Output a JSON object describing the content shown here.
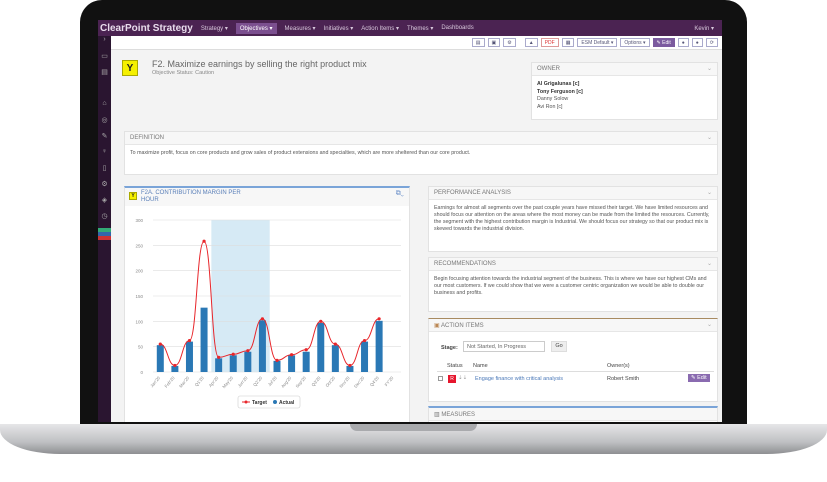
{
  "nav": {
    "brand": "ClearPoint Strategy",
    "items": [
      "Strategy ▾",
      "Objectives ▾",
      "Measures ▾",
      "Initiatives ▾",
      "Action Items ▾",
      "Themes ▾",
      "Dashboards"
    ],
    "user": "Kevin ▾"
  },
  "toolbar": {
    "buttons": [
      "▤",
      "▣",
      "⚙",
      "▲",
      "PDF",
      "▦",
      "ESM Default ▾",
      "Options ▾",
      "✎ Edit",
      "●",
      "●",
      "⟳"
    ]
  },
  "objective": {
    "status_letter": "Y",
    "title": "F2. Maximize earnings by selling the right product mix",
    "status_text": "Objective Status: Caution"
  },
  "owner": {
    "heading": "OWNER",
    "names": [
      "Al Grigalunas [c]",
      "Tony Ferguson [c]",
      "Danny Solow",
      "Avi Ron [c]"
    ]
  },
  "definition": {
    "heading": "DEFINITION",
    "text": "To maximize profit, focus on core products and grow sales of product extensions and specialties, which are more sheltered than our core product."
  },
  "performance": {
    "heading": "PERFORMANCE ANALYSIS",
    "text": "Earnings for almost all segments over the past couple years have missed their target.  We have limited resources and should focus our attention on the areas where the most money can be made from the limited the resources.  Currently, the segment with the highest contribution margin is Industrial.  We should focus our strategy so that our product mix is skewed towards the industrial division."
  },
  "recommendations": {
    "heading": "RECOMMENDATIONS",
    "text": "Begin focusing attention towards the industrial segment of the business.  This is where we have our highest CMs and our most customers.  If we could show that we were a customer centric organization we would be able to double our business and profits."
  },
  "action_items": {
    "heading": "ACTION ITEMS",
    "stage_label": "Stage:",
    "stage_value": "Not Started, In Progress",
    "go": "Go",
    "columns": [
      "Status",
      "Name",
      "Owner(s)"
    ],
    "rows": [
      {
        "status": "R",
        "name": "Engage finance with critical analysis",
        "owner": "Robert Smith",
        "edit": "✎ Edit"
      }
    ]
  },
  "measures": {
    "heading": "MEASURES"
  },
  "chart_panel": {
    "status_letter": "Y",
    "title": "F2A. CONTRIBUTION MARGIN PER HOUR"
  },
  "colors": {
    "target": "#e8262b",
    "actual": "#2a78b5",
    "band": "#d6eaf5",
    "nav": "#4b2352"
  },
  "chart_data": {
    "type": "bar",
    "title": "F2A. CONTRIBUTION MARGIN PER HOUR",
    "categories": [
      "Jan'20",
      "Feb'20",
      "Mar'20",
      "Q1'20",
      "Apr'20",
      "May'20",
      "Jun'20",
      "Q2'20",
      "Jul'20",
      "Aug'20",
      "Sep'20",
      "Q3'20",
      "Oct'20",
      "Nov'20",
      "Dec'20",
      "Q4'20",
      "FY'20"
    ],
    "series": [
      {
        "name": "Target",
        "type": "line",
        "values": [
          55,
          13,
          62,
          258,
          29,
          35,
          42,
          105,
          23,
          34,
          44,
          100,
          55,
          13,
          62,
          105,
          null
        ]
      },
      {
        "name": "Actual",
        "type": "bar",
        "values": [
          53,
          12,
          60,
          127,
          27,
          33,
          40,
          102,
          22,
          33,
          40,
          97,
          53,
          12,
          60,
          101,
          null
        ]
      }
    ],
    "ylim": [
      0,
      300
    ],
    "yticks": [
      0,
      50,
      100,
      150,
      200,
      250,
      300
    ],
    "highlight_range": [
      "Apr'20",
      "Q2'20"
    ],
    "legend": "bottom",
    "grid": true
  }
}
